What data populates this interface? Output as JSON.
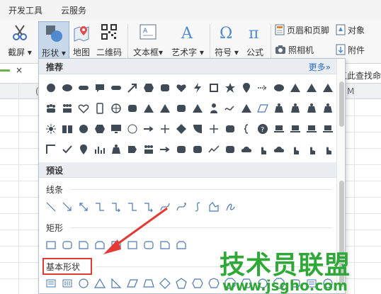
{
  "menu": {
    "items": [
      "开发工具",
      "云服务"
    ]
  },
  "ribbon": {
    "screenshot_label": "截屏",
    "shape_label": "形状",
    "map_label": "地图",
    "qrcode_label": "二维码",
    "textbox_label": "文本框",
    "wordart_label": "艺术字",
    "symbol_label": "符号",
    "formula_label": "公式",
    "header_footer_label": "页眉和页脚",
    "object_label": "对象",
    "camera_label": "照相机",
    "attachment_label": "附件"
  },
  "formula_bar": {
    "tab_x": "×",
    "right_label": "点此查找命"
  },
  "sheet": {
    "col_mid": "(",
    "col_right": "M"
  },
  "dropdown": {
    "recommended_title": "推荐",
    "more_link": "更多»",
    "preset_title": "预设",
    "lines_title": "线条",
    "rect_title": "矩形",
    "basic_title": "基本形状"
  },
  "colors": {
    "accent": "#2a6fcf",
    "highlight": "#e53935",
    "watermark": "#2ea836",
    "shape": "#3f4a57",
    "outline": "#4a78b4"
  },
  "watermark": {
    "title": "技术员联盟",
    "url": "www.jsgho.com"
  }
}
